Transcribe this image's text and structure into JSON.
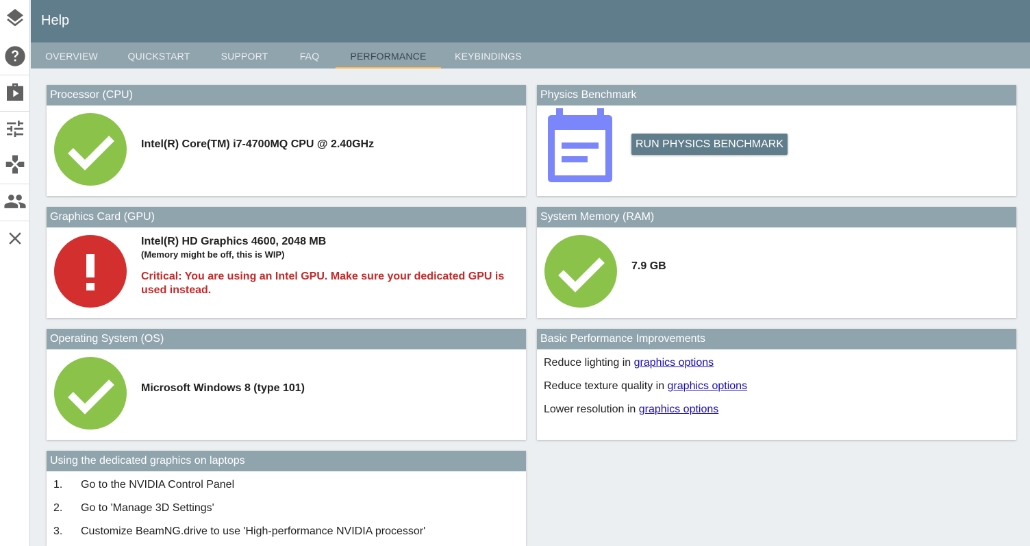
{
  "header": {
    "title": "Help"
  },
  "tabs": [
    {
      "label": "OVERVIEW"
    },
    {
      "label": "QUICKSTART"
    },
    {
      "label": "SUPPORT"
    },
    {
      "label": "FAQ"
    },
    {
      "label": "PERFORMANCE",
      "active": true
    },
    {
      "label": "KEYBINDINGS"
    }
  ],
  "sidebar": {
    "icons": [
      "layers-icon",
      "help-icon",
      "play-case-icon",
      "tune-icon",
      "gamepad-icon",
      "people-icon",
      "close-icon"
    ]
  },
  "cpu": {
    "title": "Processor (CPU)",
    "status": "ok",
    "name": "Intel(R) Core(TM) i7-4700MQ CPU @ 2.40GHz"
  },
  "gpu": {
    "title": "Graphics Card (GPU)",
    "status": "critical",
    "name": "Intel(R) HD Graphics 4600, 2048 MB",
    "note": "(Memory might be off, this is WIP)",
    "warning": "Critical: You are using an Intel GPU. Make sure your dedicated GPU is used instead."
  },
  "os": {
    "title": "Operating System (OS)",
    "status": "ok",
    "name": "Microsoft Windows 8 (type 101)"
  },
  "physics": {
    "title": "Physics Benchmark",
    "button_label": "RUN PHYSICS BENCHMARK"
  },
  "ram": {
    "title": "System Memory (RAM)",
    "status": "ok",
    "amount": "7.9 GB"
  },
  "improvements": {
    "title": "Basic Performance Improvements",
    "items": [
      {
        "text": "Reduce lighting in ",
        "link": "graphics options"
      },
      {
        "text": "Reduce texture quality in ",
        "link": "graphics options"
      },
      {
        "text": "Lower resolution in ",
        "link": "graphics options"
      }
    ]
  },
  "laptop": {
    "title": "Using the dedicated graphics on laptops",
    "steps": [
      {
        "num": "1.",
        "text": "Go to the NVIDIA Control Panel"
      },
      {
        "num": "2.",
        "text": "Go to 'Manage 3D Settings'"
      },
      {
        "num": "3.",
        "text": "Customize BeamNG.drive to use 'High-performance NVIDIA processor'"
      }
    ]
  },
  "colors": {
    "header": "#607d8b",
    "tabbar": "#90a4ae",
    "tab_active_underline": "#ffb74d",
    "ok": "#8bc34a",
    "critical": "#d32f2f",
    "benchmark_icon": "#7b86fb",
    "link": "#1a0dab"
  }
}
